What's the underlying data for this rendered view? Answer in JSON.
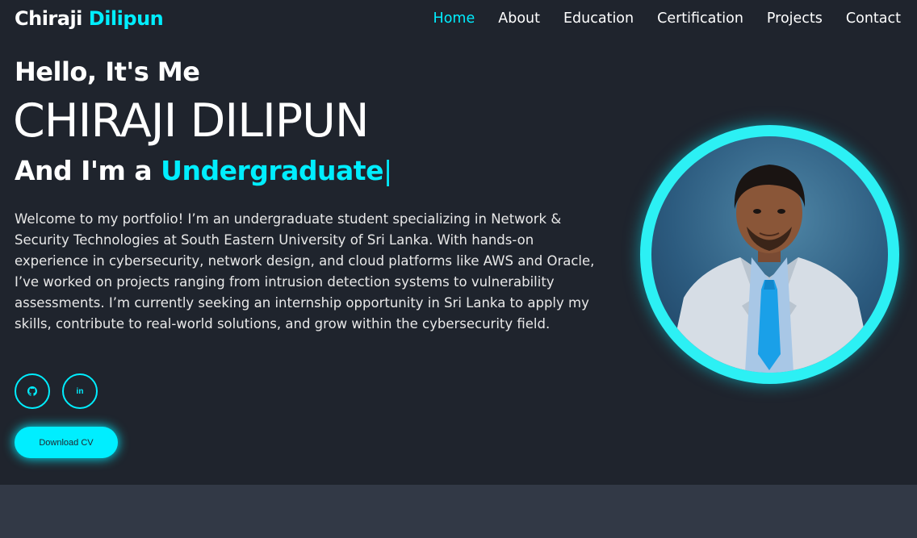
{
  "header": {
    "logo_first": "Chiraji",
    "logo_second": "Dilipun",
    "nav": [
      {
        "label": "Home",
        "active": true
      },
      {
        "label": "About"
      },
      {
        "label": "Education"
      },
      {
        "label": "Certification"
      },
      {
        "label": "Projects"
      },
      {
        "label": "Contact"
      }
    ]
  },
  "hero": {
    "greeting": "Hello, It's Me",
    "name": "CHIRAJI DILIPUN",
    "role_prefix": "And I'm a",
    "role_typed": "Undergraduate",
    "caret": "|",
    "bio": "Welcome to my portfolio! I’m an undergraduate student specializing in Network & Security Technologies at South Eastern University of Sri Lanka. With hands-on experience in cybersecurity, network design, and cloud platforms like AWS and Oracle, I’ve worked on projects ranging from intrusion detection systems to vulnerability assessments. I’m currently seeking an internship opportunity in Sri Lanka to apply my skills, contribute to real-world solutions, and grow within the cybersecurity field.",
    "social": [
      {
        "icon": "github-icon"
      },
      {
        "icon": "linkedin-icon",
        "text": "in"
      }
    ],
    "download_cv": "Download CV"
  },
  "colors": {
    "accent": "#00eeff",
    "background": "#1f242d",
    "second_background": "#323946"
  }
}
